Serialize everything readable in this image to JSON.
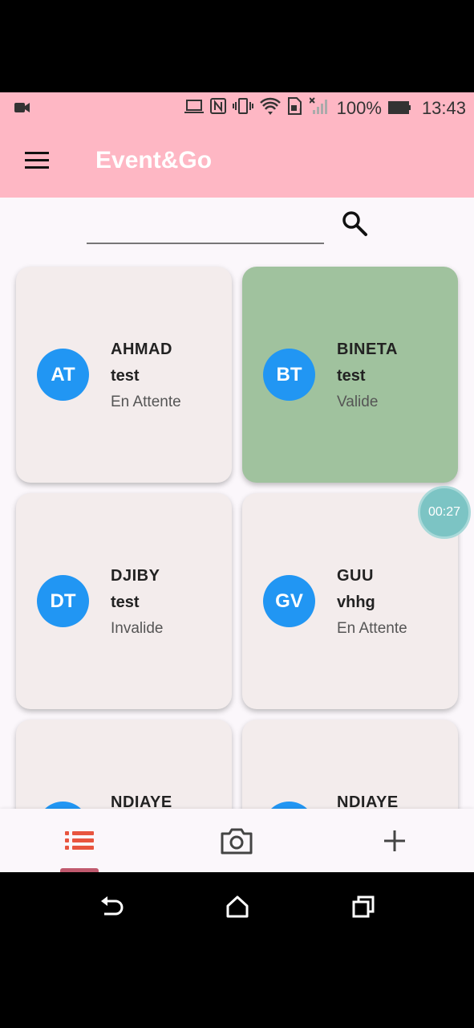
{
  "status_bar": {
    "battery_percent": "100%",
    "time": "13:43",
    "icons": [
      "video-camera-icon",
      "laptop-icon",
      "nfc-icon",
      "vibrate-icon",
      "wifi-icon",
      "sim-icon",
      "no-signal-icon",
      "battery-icon"
    ]
  },
  "app_bar": {
    "title": "Event&Go",
    "menu_icon": "hamburger-menu-icon"
  },
  "search": {
    "value": "",
    "placeholder": "",
    "icon": "search-icon"
  },
  "cards": [
    {
      "initials": "AT",
      "name": "AHMAD",
      "subtitle": "test",
      "status": "En Attente",
      "status_type": "pending"
    },
    {
      "initials": "BT",
      "name": "BINETA",
      "subtitle": "test",
      "status": "Valide",
      "status_type": "valid"
    },
    {
      "initials": "DT",
      "name": "DJIBY",
      "subtitle": "test",
      "status": "Invalide",
      "status_type": "invalid"
    },
    {
      "initials": "GV",
      "name": "GUU",
      "subtitle": "vhhg",
      "status": "En Attente",
      "status_type": "pending"
    },
    {
      "initials": "",
      "name": "NDIAYE",
      "subtitle": "",
      "status": "",
      "status_type": "pending"
    },
    {
      "initials": "",
      "name": "NDIAYE",
      "subtitle": "",
      "status": "",
      "status_type": "pending"
    }
  ],
  "timer": {
    "value": "00:27"
  },
  "bottom_nav": {
    "items": [
      {
        "icon": "list-icon",
        "active": true
      },
      {
        "icon": "camera-icon",
        "active": false
      },
      {
        "icon": "add-icon",
        "active": false
      }
    ]
  },
  "colors": {
    "app_bar": "#feb7c4",
    "card_default": "#f3ecec",
    "card_valid": "#a0c29e",
    "avatar": "#2196f3",
    "active_nav": "#e8553f"
  }
}
